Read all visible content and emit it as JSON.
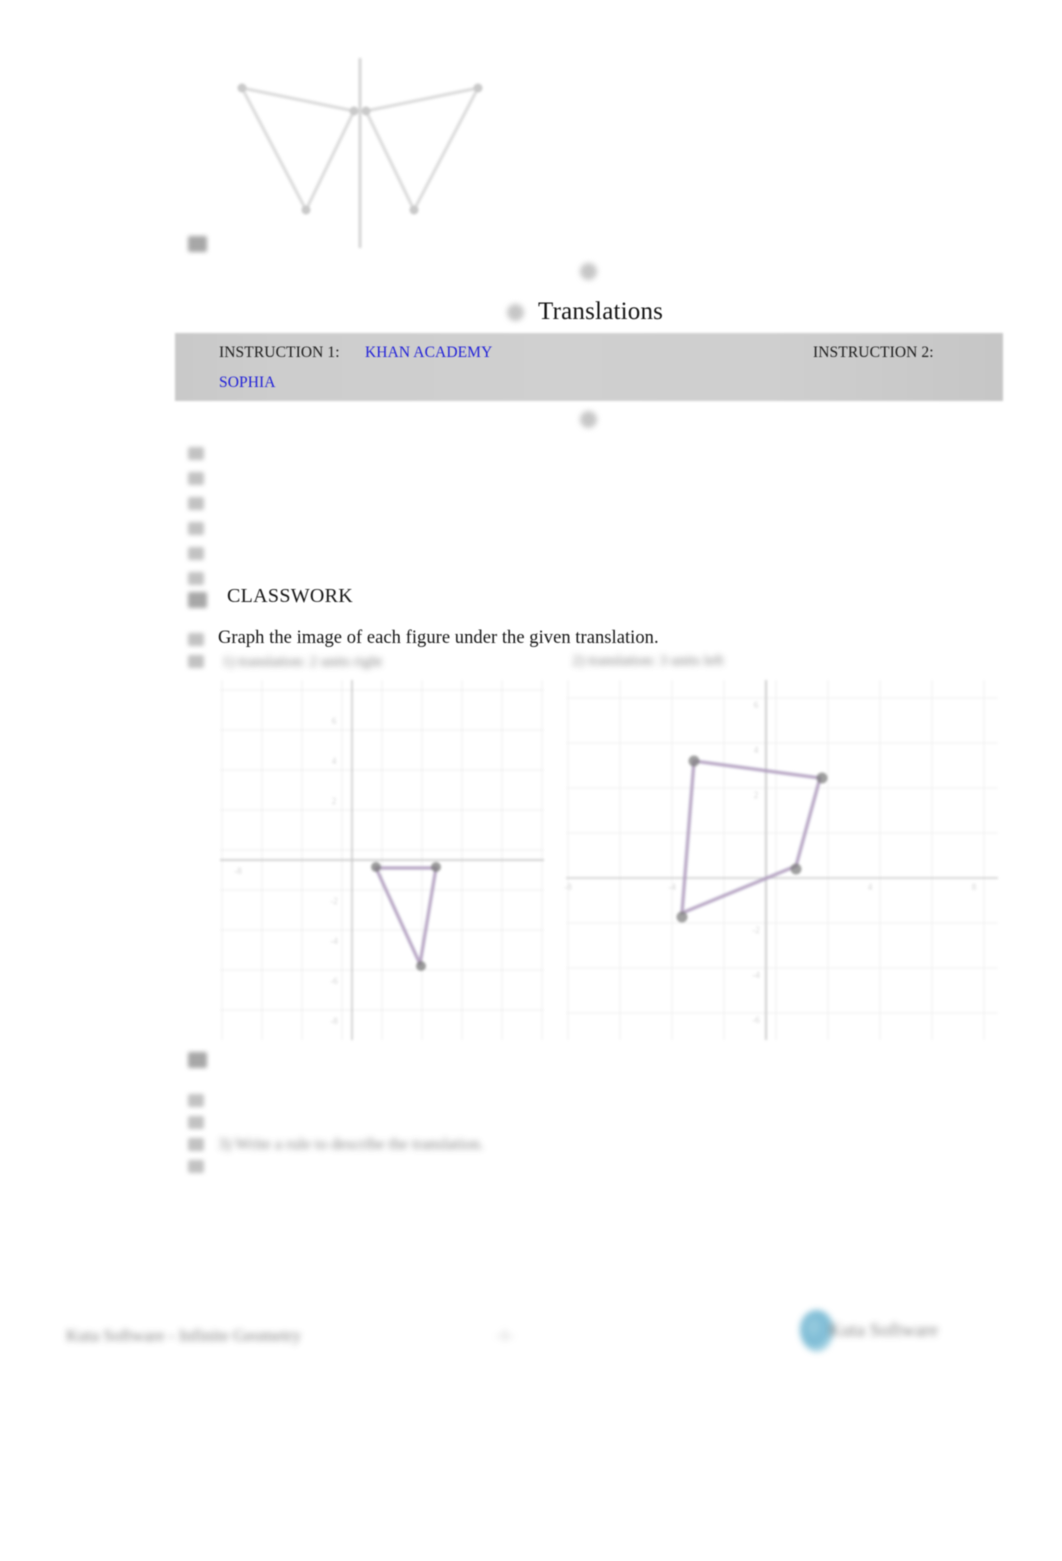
{
  "document": {
    "title": "Translations",
    "type": "math-worksheet"
  },
  "instruction_band": {
    "instruction_1_label": "INSTRUCTION 1:",
    "instruction_1_link": "KHAN ACADEMY",
    "instruction_2_label": "INSTRUCTION 2:",
    "instruction_2_link": "SOPHIA",
    "band_color": "#cdcdcd",
    "link_color": "#2020d8"
  },
  "classwork": {
    "heading": "CLASSWORK",
    "directions": "Graph the image of each figure under the given translation.",
    "problem_1_label": "1)  translation: 2 units right",
    "problem_2_label": "2)  translation: 3 units left"
  },
  "question_3": {
    "text": "3)  Write a rule to describe the translation."
  },
  "footer": {
    "left_text": "Kuta Software - Infinite Geometry",
    "page_number": "-1-",
    "logo_text": "Kuta Software",
    "logo_mark_color": "#6eb4d0"
  },
  "chart_data": [
    {
      "type": "scatter",
      "title": "Problem 1 coordinate plane",
      "xlim": [
        -8,
        8
      ],
      "ylim": [
        -8,
        8
      ],
      "grid": true,
      "axis_color": "#b9b9b9",
      "grid_color": "#e9e9e9",
      "shape_color": "#9a93b8",
      "vertex_color": "#6d6d6d",
      "figures": [
        {
          "name": "preimage-triangle",
          "points": [
            [
              0.6,
              -0.6
            ],
            [
              3.1,
              -0.5
            ],
            [
              2.2,
              -5.1
            ]
          ]
        }
      ]
    },
    {
      "type": "scatter",
      "title": "Problem 2 coordinate plane",
      "xlim": [
        -8,
        8
      ],
      "ylim": [
        -8,
        8
      ],
      "grid": true,
      "axis_color": "#b9b9b9",
      "grid_color": "#e9e9e9",
      "shape_color": "#9a93b8",
      "vertex_color": "#6d6d6d",
      "figures": [
        {
          "name": "preimage-quadrilateral",
          "points": [
            [
              -2.6,
              3.4
            ],
            [
              1.3,
              2.9
            ],
            [
              0.7,
              -0.4
            ],
            [
              -3.4,
              -1.7
            ]
          ]
        }
      ]
    }
  ],
  "top_figure": {
    "description": "two mirrored triangles about a vertical line of reflection",
    "stroke_color": "#d8d8d8"
  }
}
